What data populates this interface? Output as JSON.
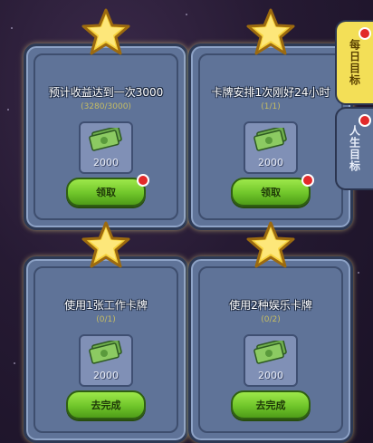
{
  "tabs": [
    {
      "label": "每日目标",
      "active": true,
      "badge": true
    },
    {
      "label": "人生目标",
      "active": false,
      "badge": true
    }
  ],
  "goals": [
    {
      "title": "预计收益达到一次3000",
      "progress": "(3280/3000)",
      "reward": "2000",
      "button": "领取",
      "badge": true
    },
    {
      "title": "卡牌安排1次刚好24小时",
      "progress": "(1/1)",
      "reward": "2000",
      "button": "领取",
      "badge": true
    },
    {
      "title": "使用1张工作卡牌",
      "progress": "(0/1)",
      "reward": "2000",
      "button": "去完成",
      "badge": false
    },
    {
      "title": "使用2种娱乐卡牌",
      "progress": "(0/2)",
      "reward": "2000",
      "button": "去完成",
      "badge": false
    }
  ],
  "colors": {
    "button_green": "#6fc52a",
    "tab_active": "#f3df57",
    "card": "#5f7398",
    "badge": "#e22a2a"
  },
  "icons": {
    "star": "star-icon",
    "reward": "money-icon"
  }
}
